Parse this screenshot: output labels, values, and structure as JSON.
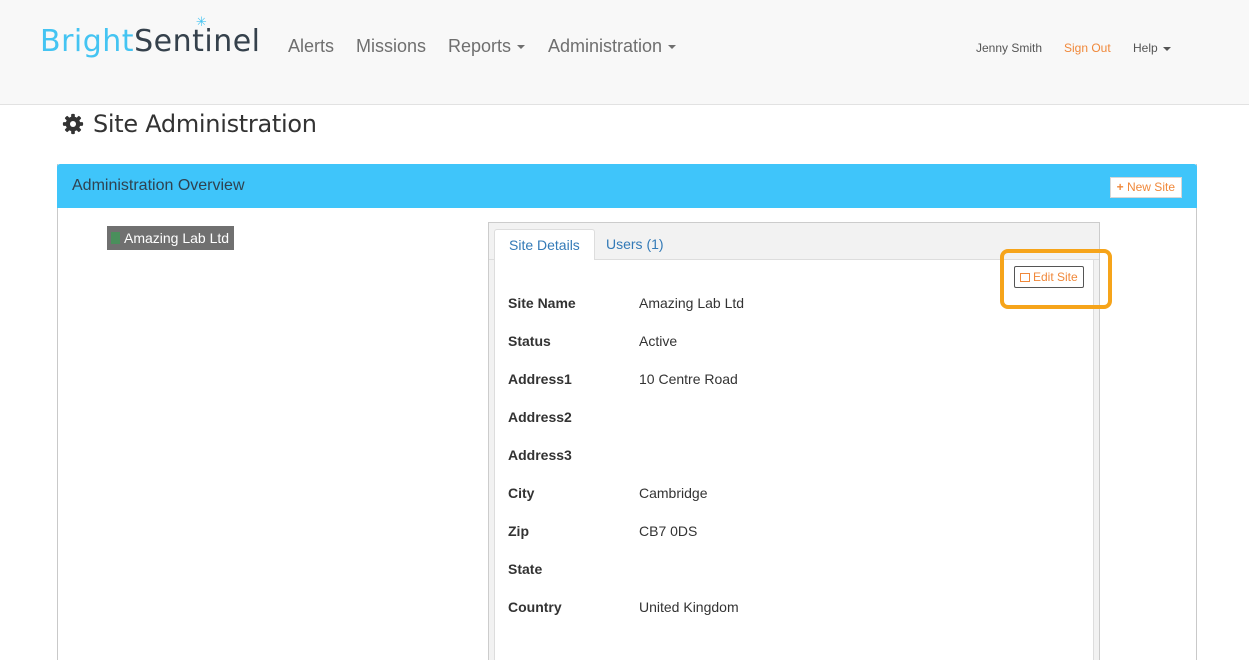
{
  "brand": {
    "part1": "Bright",
    "part2": "Sentinel",
    "spark_glyph": "✳",
    "colors": {
      "light": "#44c4f2",
      "dark": "#35414c"
    }
  },
  "nav": {
    "alerts": "Alerts",
    "missions": "Missions",
    "reports": "Reports",
    "administration": "Administration",
    "user": "Jenny Smith",
    "sign_out": "Sign Out",
    "help": "Help"
  },
  "page": {
    "title": "Site Administration",
    "icon": "gear-icon"
  },
  "panel": {
    "title": "Administration Overview",
    "new_site": "New Site",
    "new_site_icon": "plus-icon",
    "header_color": "#3fc5fa"
  },
  "tree": {
    "selected": "Amazing Lab Ltd",
    "icon": "building-icon"
  },
  "tabs": {
    "active": "Site Details",
    "users": "Users (1)"
  },
  "actions": {
    "edit_site": "Edit Site",
    "edit_icon": "edit-icon",
    "highlight_color": "#f6a41a",
    "accent_color": "#f0883a"
  },
  "details": [
    {
      "label": "Site Name",
      "value": "Amazing Lab Ltd"
    },
    {
      "label": "Status",
      "value": "Active"
    },
    {
      "label": "Address1",
      "value": "10 Centre Road"
    },
    {
      "label": "Address2",
      "value": ""
    },
    {
      "label": "Address3",
      "value": ""
    },
    {
      "label": "City",
      "value": "Cambridge"
    },
    {
      "label": "Zip",
      "value": "CB7 0DS"
    },
    {
      "label": "State",
      "value": ""
    },
    {
      "label": "Country",
      "value": "United Kingdom"
    }
  ]
}
